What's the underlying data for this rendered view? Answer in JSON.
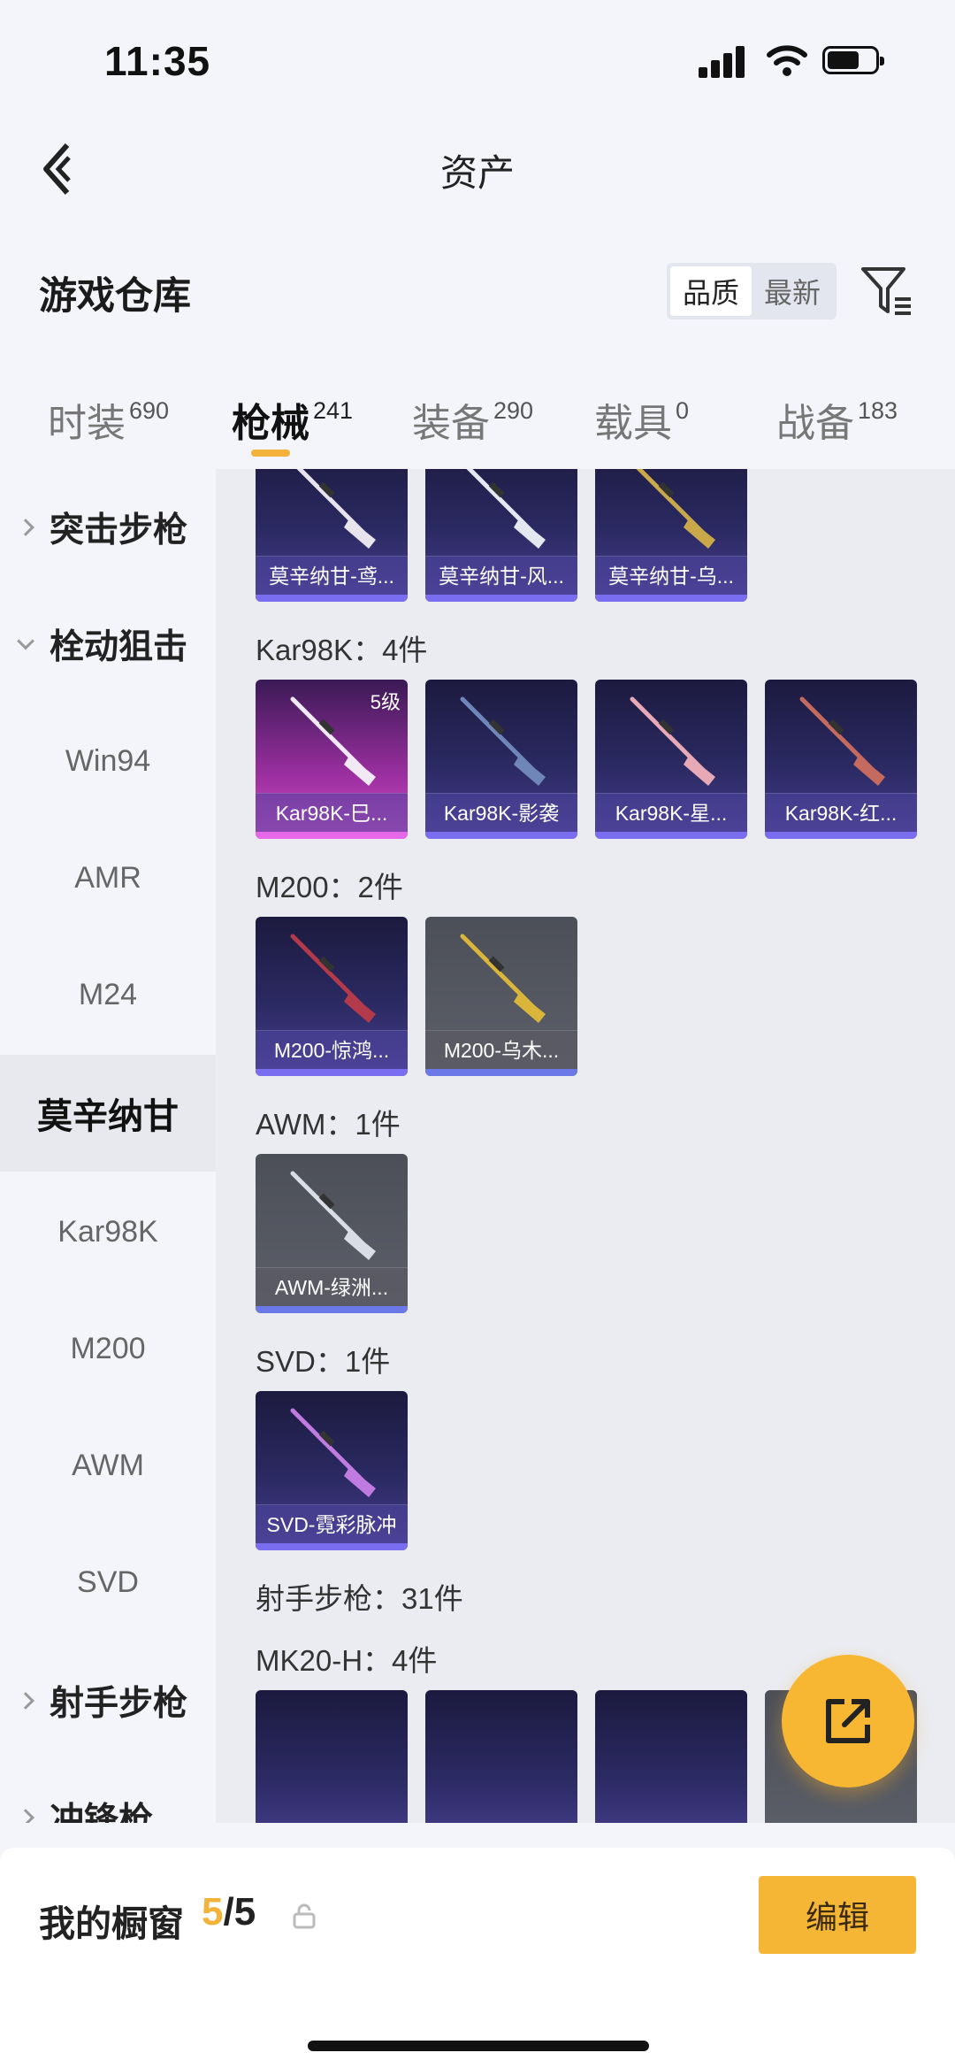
{
  "status": {
    "time": "11:35"
  },
  "header": {
    "title": "资产"
  },
  "warehouse": {
    "title": "游戏仓库",
    "sort_options": [
      {
        "label": "品质",
        "active": true
      },
      {
        "label": "最新",
        "active": false
      }
    ]
  },
  "tabs": [
    {
      "label": "时装",
      "count": "690"
    },
    {
      "label": "枪械",
      "count": "241",
      "active": true
    },
    {
      "label": "装备",
      "count": "290"
    },
    {
      "label": "载具",
      "count": "0"
    },
    {
      "label": "战备",
      "count": "183"
    }
  ],
  "sidebar": [
    {
      "label": "突击步枪",
      "type": "group",
      "expanded": false
    },
    {
      "label": "栓动狙击",
      "type": "group",
      "expanded": true
    },
    {
      "label": "Win94"
    },
    {
      "label": "AMR"
    },
    {
      "label": "M24"
    },
    {
      "label": "莫辛纳甘",
      "selected": true
    },
    {
      "label": "Kar98K"
    },
    {
      "label": "M200"
    },
    {
      "label": "AWM"
    },
    {
      "label": "SVD"
    },
    {
      "label": "射手步枪",
      "type": "group",
      "expanded": false
    },
    {
      "label": "冲锋枪",
      "type": "group",
      "expanded": false
    }
  ],
  "groups": [
    {
      "label": "",
      "items": [
        {
          "name": "莫辛纳甘-鸢...",
          "style": "purple",
          "gun_color": "#e8e4ee"
        },
        {
          "name": "莫辛纳甘-风...",
          "style": "purple",
          "gun_color": "#e4e8f0"
        },
        {
          "name": "莫辛纳甘-乌...",
          "style": "purple",
          "gun_color": "#c9a84a"
        }
      ]
    },
    {
      "label": "Kar98K：4件",
      "items": [
        {
          "name": "Kar98K-巳...",
          "style": "rare",
          "level": "5级",
          "gun_color": "#f1e9f5"
        },
        {
          "name": "Kar98K-影袭",
          "style": "purple",
          "gun_color": "#6f86b8"
        },
        {
          "name": "Kar98K-星...",
          "style": "purple",
          "gun_color": "#e7a9b5"
        },
        {
          "name": "Kar98K-红...",
          "style": "purple",
          "gun_color": "#c46a5f"
        }
      ]
    },
    {
      "label": "M200：2件",
      "items": [
        {
          "name": "M200-惊鸿...",
          "style": "purple",
          "gun_color": "#b23a4a"
        },
        {
          "name": "M200-乌木...",
          "style": "grey",
          "gun_color": "#d9b63a"
        }
      ]
    },
    {
      "label": "AWM：1件",
      "items": [
        {
          "name": "AWM-绿洲...",
          "style": "grey",
          "gun_color": "#d8dde6"
        }
      ]
    },
    {
      "label": "SVD：1件",
      "items": [
        {
          "name": "SVD-霓彩脉冲",
          "style": "purple",
          "gun_color": "#c07be0"
        }
      ]
    },
    {
      "label": "射手步枪：31件",
      "items": []
    },
    {
      "label": "MK20-H：4件",
      "items": []
    }
  ],
  "showcase": {
    "label": "我的橱窗",
    "current": "5",
    "total": "/5",
    "edit_label": "编辑"
  },
  "colors": {
    "accent": "#f3b23a",
    "background": "#f3f5fa",
    "card_purple": "#2b2a63",
    "card_rare": "#9b2fa0"
  }
}
